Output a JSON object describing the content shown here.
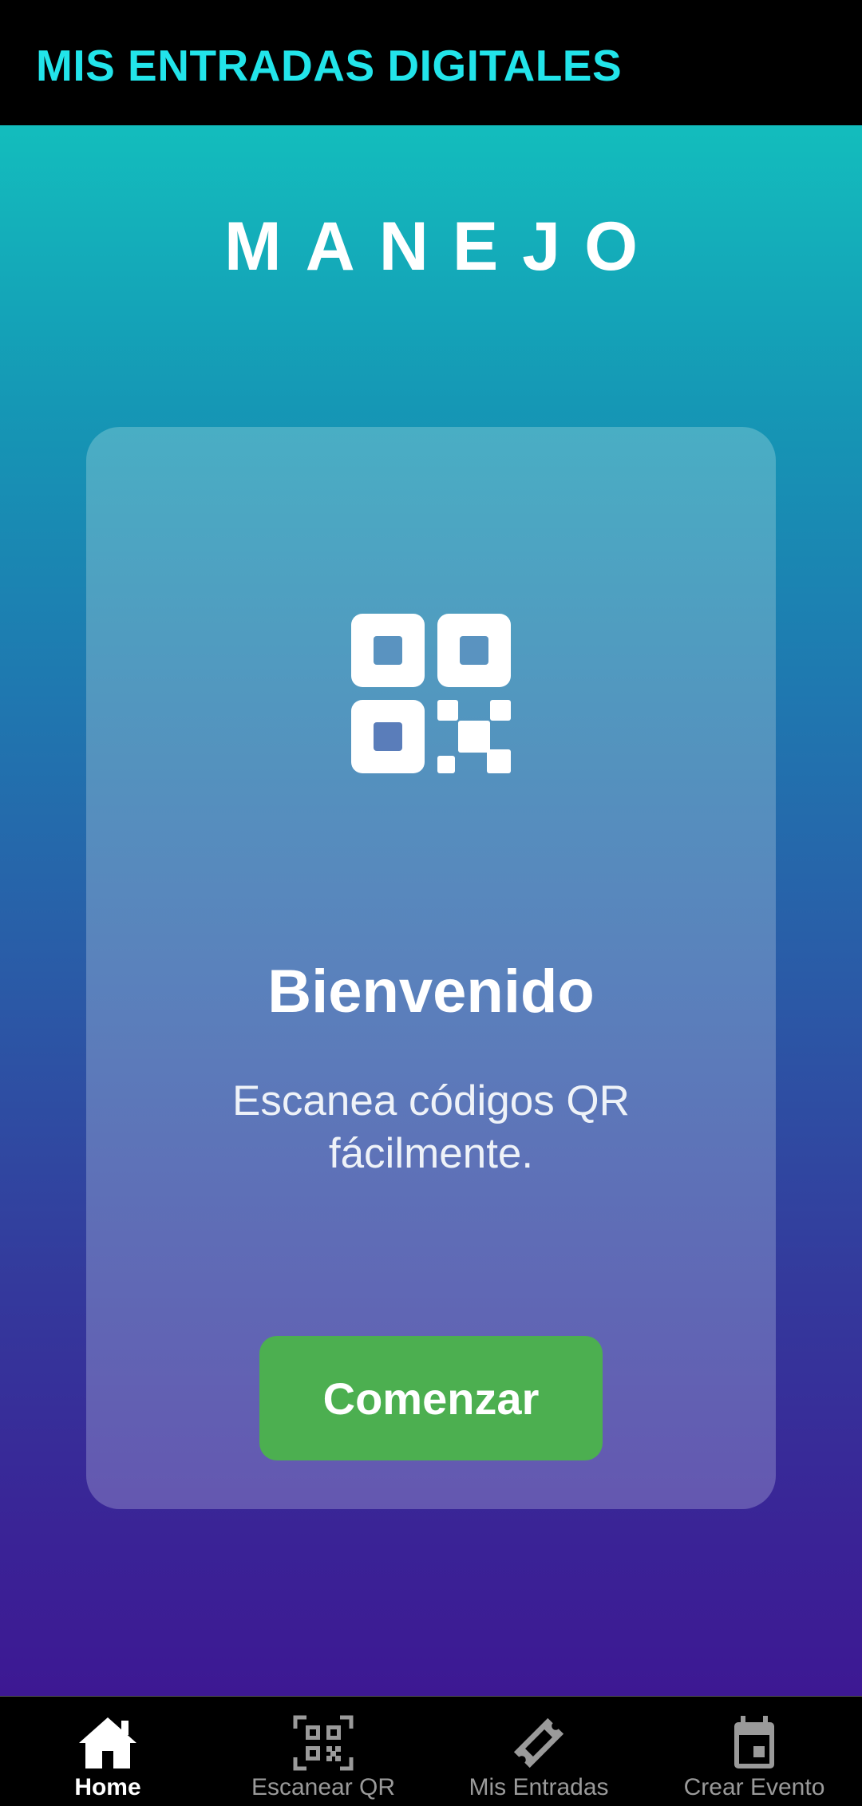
{
  "app_bar": {
    "title": "MIS ENTRADAS DIGITALES"
  },
  "brand": "MANEJO",
  "card": {
    "icon": "qr-code-icon",
    "title": "Bienvenido",
    "subtitle": "Escanea códigos QR fácilmente.",
    "button_label": "Comenzar"
  },
  "bottom_nav": {
    "items": [
      {
        "label": "Home",
        "icon": "home-icon",
        "active": true
      },
      {
        "label": "Escanear QR",
        "icon": "qr-scan-icon",
        "active": false
      },
      {
        "label": "Mis Entradas",
        "icon": "ticket-icon",
        "active": false
      },
      {
        "label": "Crear Evento",
        "icon": "calendar-icon",
        "active": false
      }
    ]
  },
  "colors": {
    "title_accent": "#22e4ea",
    "button": "#4caf50",
    "nav_active": "#ffffff",
    "nav_inactive": "#9a9a9a"
  }
}
